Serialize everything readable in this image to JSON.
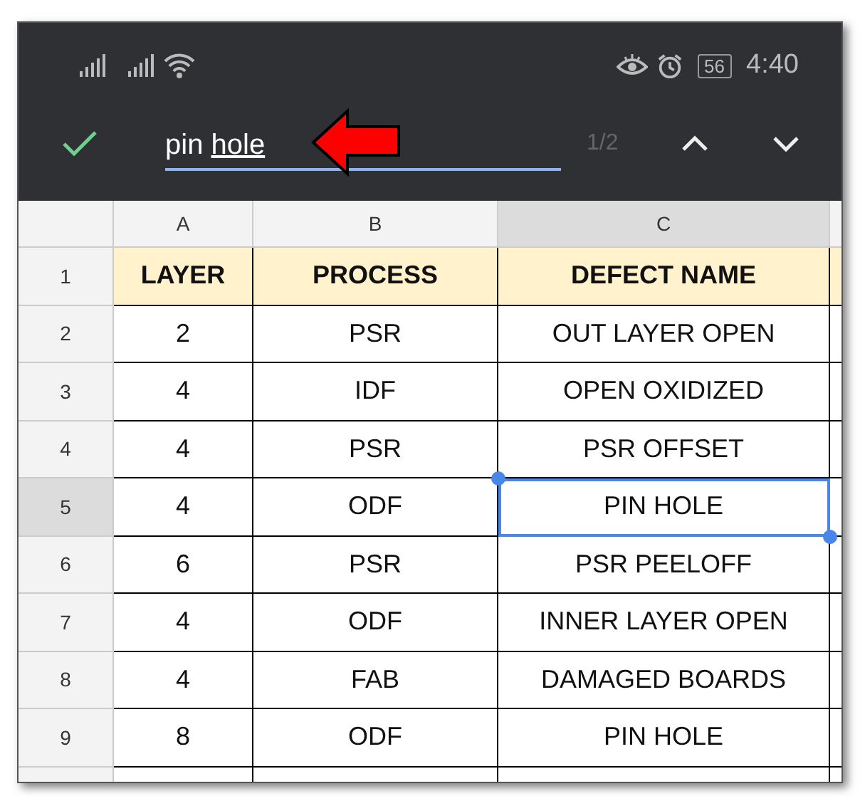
{
  "status_bar": {
    "battery": "56",
    "time": "4:40"
  },
  "search": {
    "words": [
      {
        "text": "pin",
        "underlined": false
      },
      {
        "text": "hole",
        "underlined": true
      }
    ],
    "match_count": "1/2"
  },
  "sheet": {
    "columns": [
      {
        "label": "A",
        "selected": false
      },
      {
        "label": "B",
        "selected": false
      },
      {
        "label": "C",
        "selected": true
      }
    ],
    "rows": [
      {
        "number": "1",
        "selected": false,
        "header": true,
        "cells": [
          {
            "text": "LAYER",
            "selected": false
          },
          {
            "text": "PROCESS",
            "selected": false
          },
          {
            "text": "DEFECT NAME",
            "selected": false
          }
        ]
      },
      {
        "number": "2",
        "selected": false,
        "header": false,
        "cells": [
          {
            "text": "2",
            "selected": false
          },
          {
            "text": "PSR",
            "selected": false
          },
          {
            "text": "OUT LAYER OPEN",
            "selected": false
          }
        ]
      },
      {
        "number": "3",
        "selected": false,
        "header": false,
        "cells": [
          {
            "text": "4",
            "selected": false
          },
          {
            "text": "IDF",
            "selected": false
          },
          {
            "text": "OPEN OXIDIZED",
            "selected": false
          }
        ]
      },
      {
        "number": "4",
        "selected": false,
        "header": false,
        "cells": [
          {
            "text": "4",
            "selected": false
          },
          {
            "text": "PSR",
            "selected": false
          },
          {
            "text": "PSR OFFSET",
            "selected": false
          }
        ]
      },
      {
        "number": "5",
        "selected": true,
        "header": false,
        "cells": [
          {
            "text": "4",
            "selected": false
          },
          {
            "text": "ODF",
            "selected": false
          },
          {
            "text": "PIN HOLE",
            "selected": true
          }
        ]
      },
      {
        "number": "6",
        "selected": false,
        "header": false,
        "cells": [
          {
            "text": "6",
            "selected": false
          },
          {
            "text": "PSR",
            "selected": false
          },
          {
            "text": "PSR PEELOFF",
            "selected": false
          }
        ]
      },
      {
        "number": "7",
        "selected": false,
        "header": false,
        "cells": [
          {
            "text": "4",
            "selected": false
          },
          {
            "text": "ODF",
            "selected": false
          },
          {
            "text": "INNER LAYER OPEN",
            "selected": false
          }
        ]
      },
      {
        "number": "8",
        "selected": false,
        "header": false,
        "cells": [
          {
            "text": "4",
            "selected": false
          },
          {
            "text": "FAB",
            "selected": false
          },
          {
            "text": "DAMAGED BOARDS",
            "selected": false
          }
        ]
      },
      {
        "number": "9",
        "selected": false,
        "header": false,
        "cells": [
          {
            "text": "8",
            "selected": false
          },
          {
            "text": "ODF",
            "selected": false
          },
          {
            "text": "PIN HOLE",
            "selected": false
          }
        ]
      }
    ]
  }
}
